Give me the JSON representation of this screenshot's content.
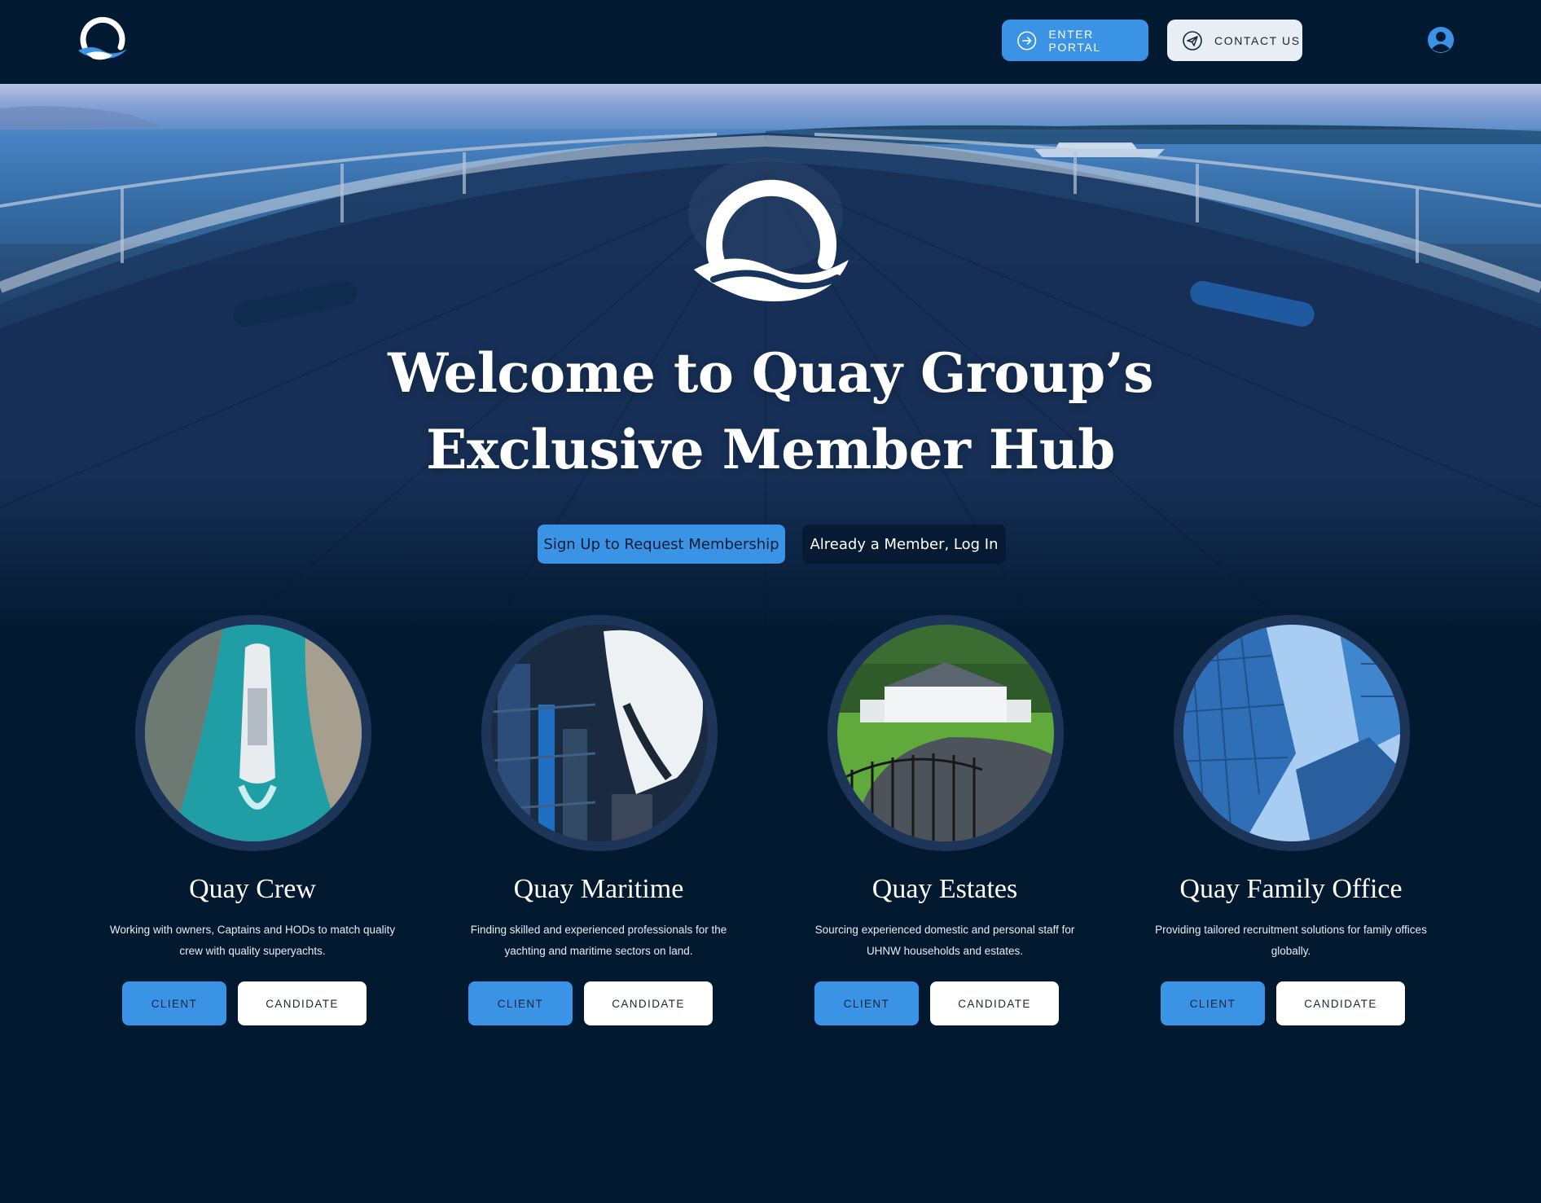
{
  "header": {
    "enter_portal": "ENTER PORTAL",
    "contact_us": "CONTACT US"
  },
  "hero": {
    "title_line1": "Welcome to Quay Group’s",
    "title_line2": "Exclusive Member Hub",
    "signup_label": "Sign Up to Request Membership",
    "login_label": "Already a Member, Log In"
  },
  "services": [
    {
      "title": "Quay Crew",
      "desc_line1": "Working with owners, Captains and HODs to match quality",
      "desc_line2": "crew with quality superyachts.",
      "client": "CLIENT",
      "candidate": "CANDIDATE"
    },
    {
      "title": "Quay Maritime",
      "desc_line1": "Finding skilled and experienced professionals for the",
      "desc_line2": "yachting and maritime sectors on land.",
      "client": "CLIENT",
      "candidate": "CANDIDATE"
    },
    {
      "title": "Quay Estates",
      "desc_line1": "Sourcing experienced domestic and personal staff for",
      "desc_line2": "UHNW households and estates.",
      "client": "CLIENT",
      "candidate": "CANDIDATE"
    },
    {
      "title": "Quay Family Office",
      "desc_line1": "Providing tailored recruitment solutions for family offices",
      "desc_line2": "globally.",
      "client": "CLIENT",
      "candidate": "CANDIDATE"
    }
  ],
  "colors": {
    "background": "#021930",
    "accent": "#3b93e6",
    "ring": "#1d3558"
  },
  "icons": {
    "logo": "quay-wave-logo",
    "portal": "arrow-right-circle-icon",
    "contact": "paper-plane-icon",
    "account": "user-circle-icon"
  }
}
